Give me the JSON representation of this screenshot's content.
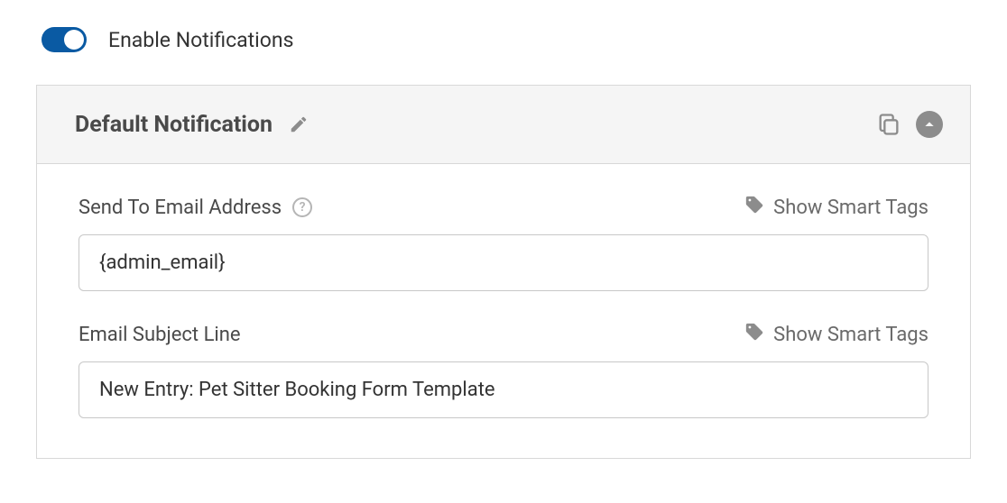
{
  "toggle": {
    "label": "Enable Notifications",
    "on": true
  },
  "panel": {
    "title": "Default Notification"
  },
  "fields": {
    "sendTo": {
      "label": "Send To Email Address",
      "smartTagsLabel": "Show Smart Tags",
      "value": "{admin_email}"
    },
    "subject": {
      "label": "Email Subject Line",
      "smartTagsLabel": "Show Smart Tags",
      "value": "New Entry: Pet Sitter Booking Form Template"
    }
  }
}
